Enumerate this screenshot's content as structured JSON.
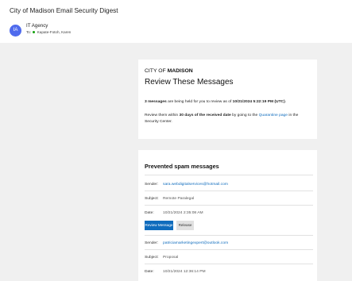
{
  "email": {
    "subject": "City of Madison Email Security Digest",
    "avatar_initials": "IA",
    "sender": "IT Agency",
    "to_prefix": "To:",
    "recipient": "Kapate-Fotoh, Karen"
  },
  "digest": {
    "city_prefix": "CITY OF",
    "city_name": "MADISON",
    "title": "Review These Messages",
    "held_count": "3 messages",
    "held_text": "are being held for you to review as of",
    "held_date": "10/21/2024 5:22:19 PM (UTC)",
    "held_end": ".",
    "review_prefix": "Review them within",
    "review_days": "30 days of the received date",
    "review_mid": "by going to the",
    "review_link": "Quarantine page",
    "review_suffix": "in the Security Center."
  },
  "spam": {
    "title": "Prevented spam messages",
    "labels": {
      "sender": "Sender:",
      "subject": "Subject:",
      "date": "Date:"
    },
    "buttons": {
      "review": "Review Message",
      "release": "Release"
    },
    "messages": [
      {
        "sender": "sara.webdigitalservices@hotmail.com",
        "subject": "Remote Paralegal",
        "date": "10/21/2024 2:35:08 AM"
      },
      {
        "sender": "patriciamarketingexpert@outlook.com",
        "subject": "Proposal",
        "date": "10/21/2024 12:36:14 PM"
      }
    ]
  },
  "colors": {
    "accent": "#0f6cbd",
    "avatar": "#4f6bed",
    "presence": "#13a10e",
    "background": "#f0f0f0"
  }
}
